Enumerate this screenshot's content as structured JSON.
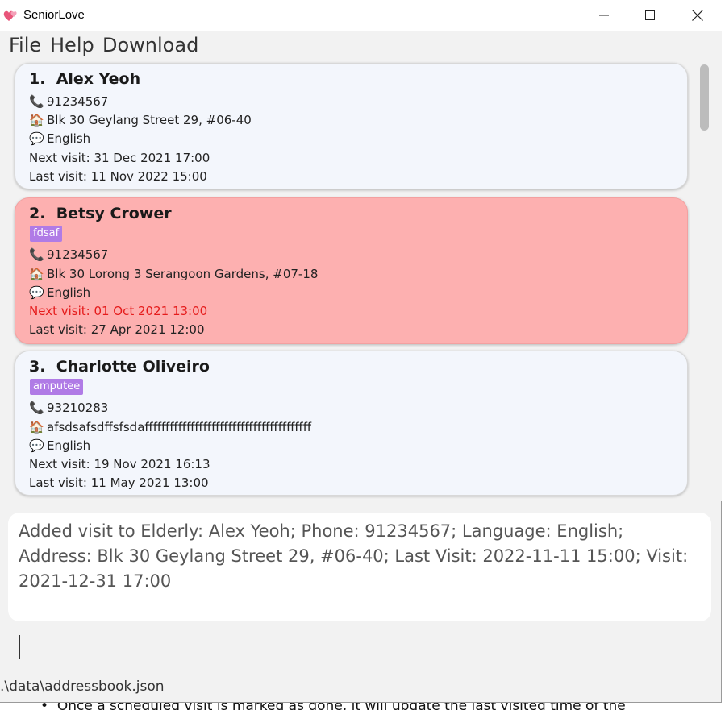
{
  "window": {
    "title": "SeniorLove",
    "icon": "hearts-icon",
    "controls": [
      "minimize-icon",
      "maximize-icon",
      "close-icon"
    ]
  },
  "menu": {
    "items": [
      "File",
      "Help",
      "Download"
    ]
  },
  "cards": [
    {
      "index": "1.",
      "name": "Alex Yeoh",
      "tag": "",
      "phone": "91234567",
      "address": "Blk 30 Geylang Street 29, #06-40",
      "language": "English",
      "next_visit": "Next visit: 31 Dec 2021 17:00",
      "last_visit": "Last visit: 11 Nov 2022 15:00"
    },
    {
      "index": "2.",
      "name": "Betsy Crower",
      "tag": "fdsaf",
      "phone": "91234567",
      "address": "Blk 30 Lorong 3 Serangoon Gardens, #07-18",
      "language": "English",
      "next_visit": "Next visit: 01 Oct 2021 13:00",
      "last_visit": "Last visit: 27 Apr 2021 12:00"
    },
    {
      "index": "3.",
      "name": "Charlotte Oliveiro",
      "tag": "amputee",
      "phone": "93210283",
      "address": "afsdsafsdffsfsdaffffffffffffffffffffffffffffffffffffffff",
      "language": "English",
      "next_visit": "Next visit: 19 Nov 2021 16:13",
      "last_visit": "Last visit: 11 May 2021 13:00"
    }
  ],
  "icons": {
    "phone": "📞",
    "address": "🏠",
    "language": "💬"
  },
  "result": {
    "text": "Added visit to Elderly: Alex Yeoh; Phone: 91234567; Language: English; Address: Blk 30 Geylang Street 29, #06-40; Last Visit: 2022-11-11 15:00; Visit: 2021-12-31 17:00"
  },
  "command": {
    "value": ""
  },
  "status": {
    "file_path": ".\\data\\addressbook.json"
  },
  "background_text": "Once a scheduled visit is marked as done, it will update the last visited time of the",
  "colors": {
    "card_bg": "#f3f6fc",
    "overdue_card_bg": "#fdb0b0",
    "overdue_text": "#e51b1b",
    "tag_bg": "#b07be6"
  }
}
